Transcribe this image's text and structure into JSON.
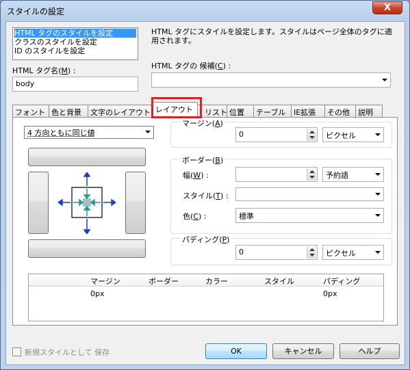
{
  "window": {
    "title": "スタイルの設定",
    "close_label": "X"
  },
  "style_list": {
    "items": [
      "HTML タグのスタイルを設定",
      "クラスのスタイルを設定",
      "ID のスタイルを設定"
    ],
    "selected_index": 0
  },
  "description": "HTML タグにスタイルを設定します。スタイルはページ全体のタグに適用されます。",
  "tag_name": {
    "label": "HTML タグ名(M) :",
    "value": "body"
  },
  "tag_candidate": {
    "label": "HTML タグの 候補(C) :",
    "value": ""
  },
  "tabs": [
    {
      "label": "フォント",
      "active": false
    },
    {
      "label": "色と背景",
      "active": false
    },
    {
      "label": "文字のレイアウト",
      "active": false
    },
    {
      "label": "レイアウト",
      "active": true
    },
    {
      "label": "リスト",
      "active": false
    },
    {
      "label": "位置",
      "active": false
    },
    {
      "label": "テーブル",
      "active": false
    },
    {
      "label": "IE拡張",
      "active": false
    },
    {
      "label": "その他",
      "active": false
    },
    {
      "label": "説明",
      "active": false
    }
  ],
  "layout": {
    "direction_select": "4 方向ともに同じ値",
    "margin": {
      "label": "マージン(A)",
      "value": "0",
      "unit": "ピクセル"
    },
    "border": {
      "label": "ボーダー(B)",
      "width_label": "幅(W) :",
      "width_value": "",
      "width_unit": "予約語",
      "style_label": "スタイル(T) :",
      "style_value": "",
      "color_label": "色(C) :",
      "color_value": "標準"
    },
    "padding": {
      "label": "パディング(P)",
      "value": "0",
      "unit": "ピクセル"
    }
  },
  "summary_table": {
    "columns": [
      "マージン",
      "ボーダー",
      "カラー",
      "スタイル",
      "パディング"
    ],
    "row": [
      "0px",
      "",
      "",
      "",
      "0px"
    ]
  },
  "footer": {
    "new_style_checkbox": "新規スタイルとして 保存",
    "ok": "OK",
    "cancel": "キャンセル",
    "help": "ヘルプ"
  },
  "colors": {
    "selection": "#3399ff",
    "highlight_box": "#e0201c",
    "arrow_blue": "#1f3fbf",
    "arrow_teal": "#2a9a8a"
  }
}
